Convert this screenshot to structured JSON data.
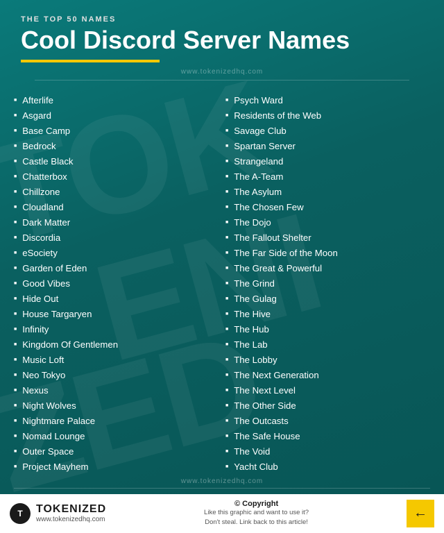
{
  "header": {
    "top_label": "THE TOP 50 NAMES",
    "main_title": "Cool Discord Server Names",
    "watermark_url": "www.tokenizedhq.com"
  },
  "left_column": [
    "Afterlife",
    "Asgard",
    "Base Camp",
    "Bedrock",
    "Castle Black",
    "Chatterbox",
    "Chillzone",
    "Cloudland",
    "Dark Matter",
    "Discordia",
    "eSociety",
    "Garden of Eden",
    "Good Vibes",
    "Hide Out",
    "House Targaryen",
    "Infinity",
    "Kingdom Of Gentlemen",
    "Music Loft",
    "Neo Tokyo",
    "Nexus",
    "Night Wolves",
    "Nightmare Palace",
    "Nomad Lounge",
    "Outer Space",
    "Project Mayhem"
  ],
  "right_column": [
    "Psych Ward",
    "Residents of the Web",
    "Savage Club",
    "Spartan Server",
    "Strangeland",
    "The A-Team",
    "The Asylum",
    "The Chosen Few",
    "The Dojo",
    "The Fallout Shelter",
    "The Far Side of the Moon",
    "The Great & Powerful",
    "The Grind",
    "The Gulag",
    "The Hive",
    "The Hub",
    "The Lab",
    "The Lobby",
    "The Next Generation",
    "The Next Level",
    "The Other Side",
    "The Outcasts",
    "The Safe House",
    "The Void",
    "Yacht Club"
  ],
  "footer": {
    "brand_name": "TOKENIZED",
    "brand_url": "www.tokenizedhq.com",
    "copyright_label": "© Copyright",
    "copyright_text": "Like this graphic and want to use it?\nDon't steal. Link back to this article!",
    "watermark_url": "www.tokenizedhq.com"
  }
}
